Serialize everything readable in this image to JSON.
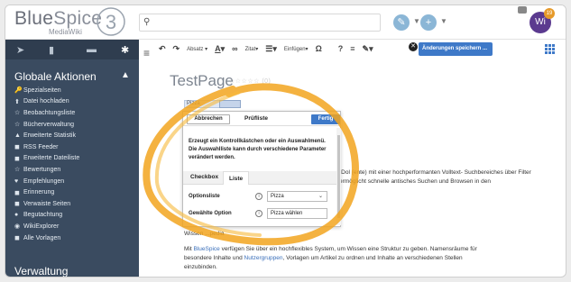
{
  "logo": {
    "name_part1": "Blue",
    "name_part2": "Spice",
    "sub": "MediaWiki",
    "numeral": "3"
  },
  "search": {
    "placeholder": ""
  },
  "user": {
    "initials": "Wi",
    "badge": "19"
  },
  "sidebar": {
    "section_title": "Globale Aktionen",
    "items": [
      {
        "icon": "🔑",
        "label": "Spezialseiten"
      },
      {
        "icon": "⬆",
        "label": "Datei hochladen"
      },
      {
        "icon": "☆",
        "label": "Beobachtungsliste"
      },
      {
        "icon": "☆",
        "label": "Bücherverwaltung"
      },
      {
        "icon": "▲",
        "label": "Erweiterte Statistik"
      },
      {
        "icon": "◼",
        "label": "RSS Feeder"
      },
      {
        "icon": "◼",
        "label": "Erweiterte Dateiliste"
      },
      {
        "icon": "☆",
        "label": "Bewertungen"
      },
      {
        "icon": "♥",
        "label": "Empfehlungen"
      },
      {
        "icon": "◼",
        "label": "Erinnerung"
      },
      {
        "icon": "◼",
        "label": "Verwaiste Seiten"
      },
      {
        "icon": "●",
        "label": "Begutachtung"
      },
      {
        "icon": "◉",
        "label": "WikiExplorer"
      },
      {
        "icon": "◼",
        "label": "Alle Vorlagen"
      }
    ],
    "bottom_section": "Verwaltung"
  },
  "toolbar": {
    "paragraph": "Absatz",
    "cite": "Zitat",
    "insert": "Einfügen",
    "save": "Änderungen speichern ..."
  },
  "page": {
    "title": "TestPage",
    "rating": "☆☆☆☆☆ (0)"
  },
  "inline_widget": {
    "value": "Pizza"
  },
  "dialog": {
    "cancel": "Abbrechen",
    "title": "Prüfliste",
    "done": "Fertig",
    "description": "Erzeugt ein Kontrollkästchen oder ein Auswahlmenü. Die Auswahlliste kann durch verschiedene Parameter verändert werden.",
    "tabs": [
      {
        "label": "Checkbox"
      },
      {
        "label": "Liste"
      }
    ],
    "options_label": "Optionsliste",
    "options_value": "Pizza",
    "selected_label": "Gewählte Option",
    "selected_value": "Pizza wählen"
  },
  "content": {
    "side_text": "-Dol   (ente) mit einer hochperformanten Volltext-  Suchbereiches über Filter ermöglicht schnelle  antisches Suchen und Browsen in den",
    "heading": "Wissen                      ...pedia",
    "para_prefix": "Mit ",
    "para_link1": "BlueSpice",
    "para_mid": " verfügen Sie über ein hochflexibles System, um Wissen eine Struktur zu geben. Namensräume für besondere Inhalte und ",
    "para_link2": "Nutzergruppen",
    "para_suffix": ", Vorlagen um Artikel zu ordnen und Inhalte an verschiedenen Stellen einzubinden."
  },
  "colors": {
    "accent": "#3e79c8",
    "sidebar_bg": "#3a4b60",
    "highlight": "#f2a51e"
  }
}
